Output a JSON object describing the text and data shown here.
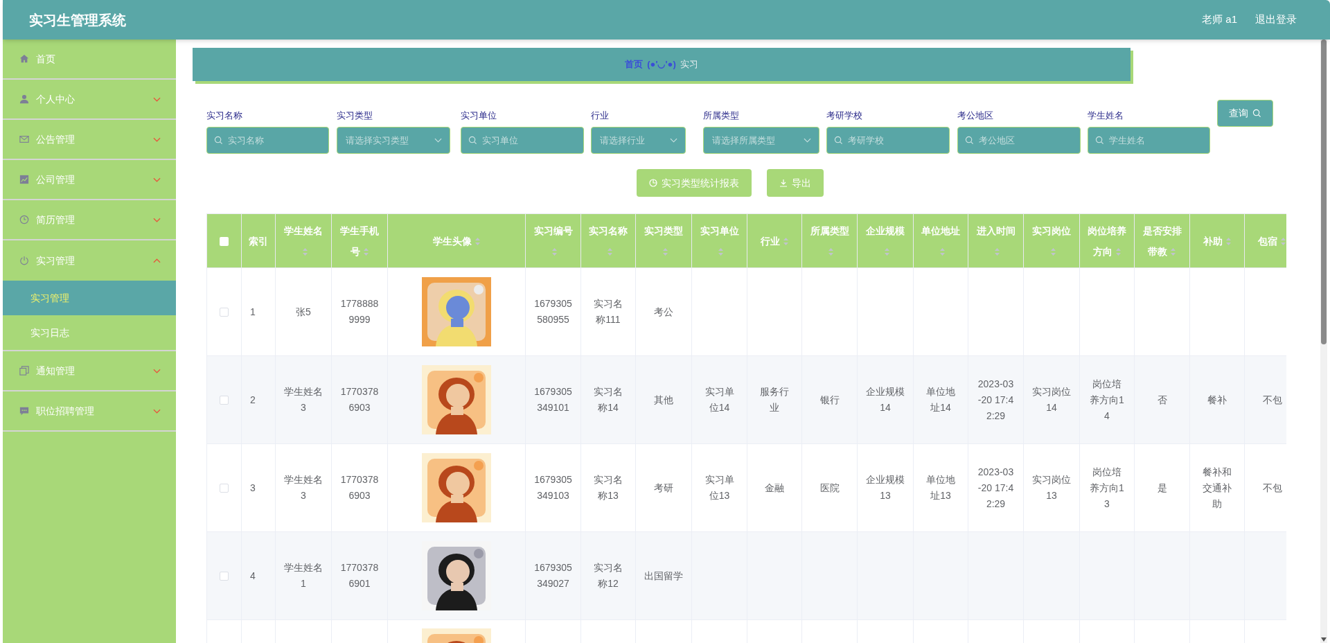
{
  "header": {
    "title": "实习生管理系统",
    "user": "老师 a1",
    "logout": "退出登录"
  },
  "sidebar": {
    "items": [
      {
        "label": "首页"
      },
      {
        "label": "个人中心",
        "expanded": false
      },
      {
        "label": "公告管理",
        "expanded": false
      },
      {
        "label": "公司管理",
        "expanded": false
      },
      {
        "label": "简历管理",
        "expanded": false
      },
      {
        "label": "实习管理",
        "expanded": true,
        "children": [
          {
            "label": "实习管理",
            "selected": true
          },
          {
            "label": "实习日志",
            "selected": false
          }
        ]
      },
      {
        "label": "通知管理",
        "expanded": false
      },
      {
        "label": "职位招聘管理",
        "expanded": false
      }
    ]
  },
  "breadcrumb": {
    "home": "首页",
    "emoticon": "(●'◡'●)",
    "current": "实习"
  },
  "filters": [
    {
      "label": "实习名称",
      "kind": "search",
      "placeholder": "实习名称"
    },
    {
      "label": "实习类型",
      "kind": "select",
      "placeholder": "请选择实习类型"
    },
    {
      "label": "实习单位",
      "kind": "search",
      "placeholder": "实习单位"
    },
    {
      "label": "行业",
      "kind": "select",
      "placeholder": "请选择行业"
    },
    {
      "label": "所属类型",
      "kind": "select",
      "placeholder": "请选择所属类型"
    },
    {
      "label": "考研学校",
      "kind": "search",
      "placeholder": "考研学校"
    },
    {
      "label": "考公地区",
      "kind": "search",
      "placeholder": "考公地区"
    },
    {
      "label": "学生姓名",
      "kind": "search",
      "placeholder": "学生姓名"
    }
  ],
  "query_button": "查询",
  "actions": [
    "实习类型统计报表",
    "导出"
  ],
  "table": {
    "select_all_checked": false,
    "columns": [
      {
        "label": "索引",
        "kind": "text",
        "sortable": false
      },
      {
        "label": "学生姓名",
        "kind": "text",
        "sortable": true
      },
      {
        "label": "学生手机号",
        "kind": "text",
        "sortable": true
      },
      {
        "label": "学生头像",
        "sortable": true
      },
      {
        "label": "实习编号",
        "kind": "text",
        "sortable": true
      },
      {
        "label": "实习名称",
        "kind": "text",
        "sortable": true
      },
      {
        "label": "实习类型",
        "kind": "text",
        "sortable": true
      },
      {
        "label": "实习单位",
        "kind": "text",
        "sortable": true
      },
      {
        "label": "行业",
        "kind": "text",
        "sortable": true
      },
      {
        "label": "所属类型",
        "kind": "text",
        "sortable": true
      },
      {
        "label": "企业规模",
        "kind": "text",
        "sortable": true
      },
      {
        "label": "单位地址",
        "kind": "text",
        "sortable": true
      },
      {
        "label": "进入时间",
        "kind": "text",
        "sortable": true
      },
      {
        "label": "实习岗位",
        "kind": "text",
        "sortable": true
      },
      {
        "label": "岗位培养方向",
        "kind": "text",
        "sortable": true
      },
      {
        "label": "是否安排带教",
        "kind": "text",
        "sortable": true
      },
      {
        "label": "补助",
        "kind": "text",
        "sortable": true
      },
      {
        "label": "包宿",
        "kind": "text",
        "sortable": true
      }
    ],
    "rows": [
      {
        "checked": false,
        "avatar": {
          "kind": "picture"
        },
        "cells": [
          "1",
          "张5",
          "17788889999",
          "1679305580955",
          "实习名称111",
          "考公"
        ]
      },
      {
        "checked": false,
        "avatar": {
          "kind": "picture"
        },
        "cells": [
          "2",
          "学生姓名3",
          "17703786903",
          "1679305349101",
          "实习名称14",
          "其他",
          "实习单位14",
          "服务行业",
          "银行",
          "企业规模14",
          "单位地址14",
          "2023-03-20 17:42:29",
          "实习岗位14",
          "岗位培养方向14",
          "否",
          "餐补",
          "不包"
        ]
      },
      {
        "checked": false,
        "avatar": {
          "kind": "picture"
        },
        "cells": [
          "3",
          "学生姓名3",
          "17703786903",
          "1679305349103",
          "实习名称13",
          "考研",
          "实习单位13",
          "金融",
          "医院",
          "企业规模13",
          "单位地址13",
          "2023-03-20 17:42:29",
          "实习岗位13",
          "岗位培养方向13",
          "是",
          "餐补和交通补助",
          "不包"
        ]
      },
      {
        "checked": false,
        "avatar": {
          "kind": "picture"
        },
        "cells": [
          "4",
          "学生姓名1",
          "17703786901",
          "1679305349027",
          "实习名称12",
          "出国留学"
        ]
      },
      {
        "avatar": {
          "kind": "picture"
        }
      }
    ]
  }
}
